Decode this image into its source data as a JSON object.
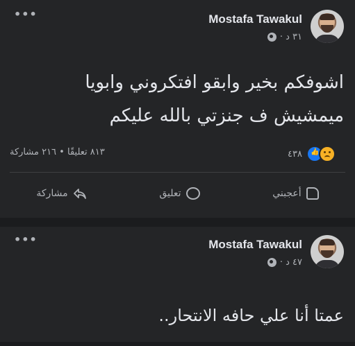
{
  "posts": [
    {
      "author": "Mostafa Tawakul",
      "time": "٣١ د ·",
      "text_lines": [
        "اشوفكم بخير وابقو افتكروني وابويا",
        "ميمشيش ف جنزتي بالله عليكم"
      ],
      "reactions_count": "٤٣٨",
      "comments_shares": "٨١٣ تعليقًا • ٢١٦ مشاركة",
      "actions": {
        "like": "أعجبني",
        "comment": "تعليق",
        "share": "مشاركة"
      }
    },
    {
      "author": "Mostafa Tawakul",
      "time": "٤٧ د ·",
      "text_lines": [
        "عمتا أنا علي حافه الانتحار.."
      ]
    }
  ],
  "colors": {
    "background": "#1b1c1e",
    "card": "#242527",
    "text": "#e4e6eb",
    "muted": "#b0b3b8",
    "like_blue": "#1877f2",
    "sad_yellow": "#f7b125"
  }
}
